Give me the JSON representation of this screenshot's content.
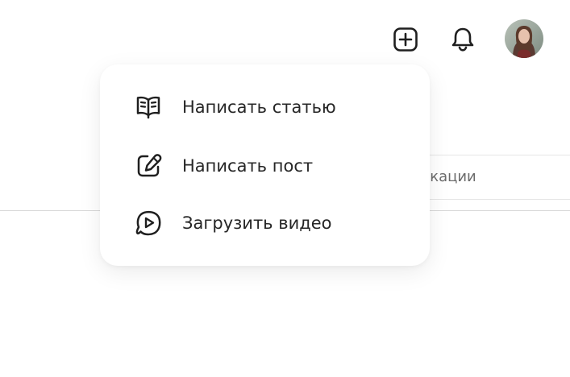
{
  "header": {
    "create_icon": "plus-square-icon",
    "notifications_icon": "bell-icon",
    "avatar_alt": ""
  },
  "background": {
    "tab_partial_label": "ликации"
  },
  "create_menu": {
    "items": [
      {
        "icon": "open-book-icon",
        "label": "Написать статью"
      },
      {
        "icon": "pencil-square-icon",
        "label": "Написать пост"
      },
      {
        "icon": "play-video-icon",
        "label": "Загрузить видео"
      }
    ]
  },
  "colors": {
    "icon_stroke": "#1f1f1f",
    "menu_text": "#262626",
    "muted_text": "#6b6b6b",
    "divider": "#e6e6e6"
  }
}
